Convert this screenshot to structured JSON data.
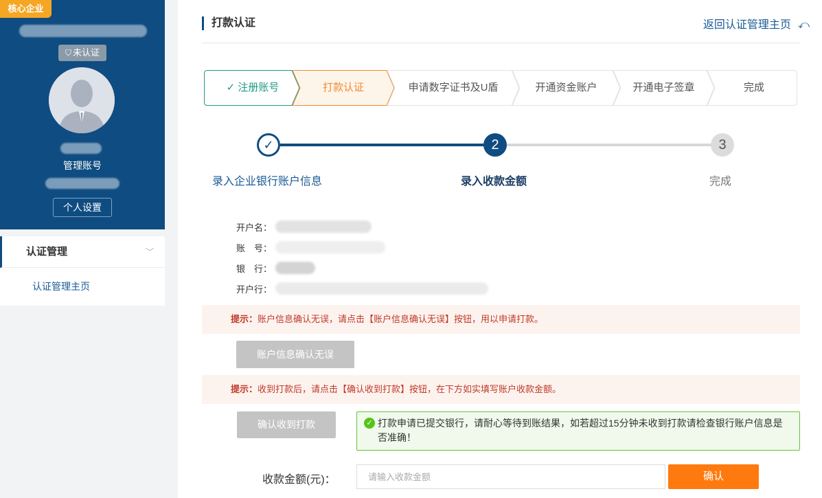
{
  "sidebar": {
    "badge": "核心企业",
    "status": "未认证",
    "role": "管理账号",
    "settings_button": "个人设置",
    "menu": {
      "section": "认证管理",
      "items": [
        {
          "label": "认证管理主页"
        }
      ]
    }
  },
  "header": {
    "title": "打款认证",
    "back_link": "返回认证管理主页"
  },
  "steps": [
    {
      "label": "注册账号",
      "state": "done"
    },
    {
      "label": "打款认证",
      "state": "active"
    },
    {
      "label": "申请数字证书及U盾",
      "state": "todo"
    },
    {
      "label": "开通资金账户",
      "state": "todo"
    },
    {
      "label": "开通电子签章",
      "state": "todo"
    },
    {
      "label": "完成",
      "state": "todo"
    }
  ],
  "progress": {
    "step1": {
      "label": "录入企业银行账户信息",
      "state": "done"
    },
    "step2": {
      "number": "2",
      "label": "录入收款金额",
      "state": "active"
    },
    "step3": {
      "number": "3",
      "label": "完成",
      "state": "todo"
    }
  },
  "account_info": {
    "name_label": "开户名：",
    "number_label": "账　号：",
    "bank_label": "银　行：",
    "branch_label": "开户行："
  },
  "tip1": {
    "prefix": "提示：",
    "text": "账户信息确认无误，请点击【账户信息确认无误】按钮，用以申请打款。"
  },
  "confirm_info_button": "账户信息确认无误",
  "tip2": {
    "prefix": "提示：",
    "text": "收到打款后，请点击【确认收到打款】按钮，在下方如实填写账户收款金额。"
  },
  "confirm_received_button": "确认收到打款",
  "success_message": "打款申请已提交银行，请耐心等待到账结果，如若超过15分钟未收到打款请检查银行账户信息是否准确！",
  "amount": {
    "label": "收款金额(元)：",
    "placeholder": "请输入收款金额",
    "value": ""
  },
  "confirm_button": "确认",
  "colors": {
    "primary": "#0f4c81",
    "accent": "#ff7a0e",
    "done": "#1f9a86",
    "active_step": "#f08c2f"
  }
}
